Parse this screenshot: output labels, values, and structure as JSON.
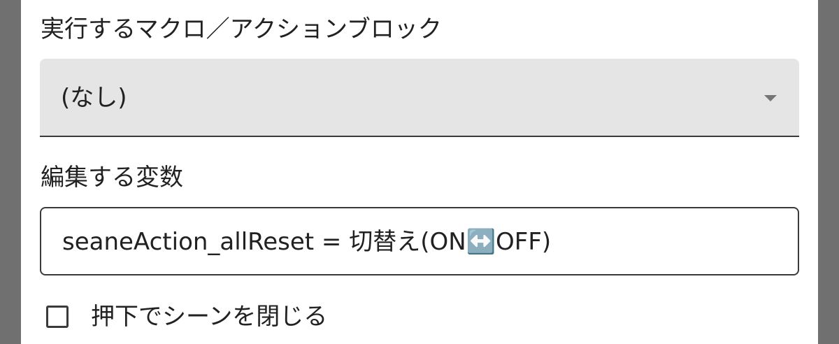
{
  "macro_section": {
    "label": "実行するマクロ／アクションブロック",
    "selected_value": "(なし)"
  },
  "variable_section": {
    "label": "編集する変数",
    "value": "seaneAction_allReset = 切替え(ON↔️OFF)"
  },
  "close_option": {
    "label": "押下でシーンを閉じる",
    "checked": false
  },
  "icons": {
    "dropdown": "chevron-down-icon",
    "checkbox": "checkbox-unchecked-icon"
  },
  "colors": {
    "backdrop": "#707070",
    "panel": "#ffffff",
    "select_fill": "#e5e5e5",
    "border": "#3a3a3a",
    "text": "#212121"
  }
}
